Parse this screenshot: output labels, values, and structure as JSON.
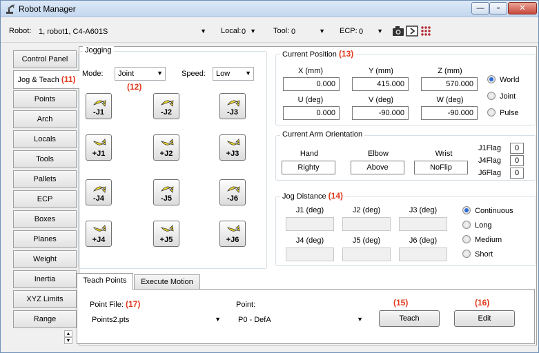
{
  "window": {
    "title": "Robot Manager",
    "close_glyph": "✕",
    "min_glyph": "—",
    "max_glyph": "▫"
  },
  "toolbar": {
    "robot_label": "Robot:",
    "robot_value": "1, robot1, C4-A601S",
    "local_label": "Local:",
    "local_value": "0",
    "tool_label": "Tool:",
    "tool_value": "0",
    "ecp_label": "ECP:",
    "ecp_value": "0",
    "icons": [
      "camera-icon",
      "play-icon",
      "io-grid-icon"
    ]
  },
  "left_tabs": [
    {
      "label": "Control Panel"
    },
    {
      "label": "Jog & Teach",
      "annotation": "(11)"
    },
    {
      "label": "Points"
    },
    {
      "label": "Arch"
    },
    {
      "label": "Locals"
    },
    {
      "label": "Tools"
    },
    {
      "label": "Pallets"
    },
    {
      "label": "ECP"
    },
    {
      "label": "Boxes"
    },
    {
      "label": "Planes"
    },
    {
      "label": "Weight"
    },
    {
      "label": "Inertia"
    },
    {
      "label": "XYZ Limits"
    },
    {
      "label": "Range"
    }
  ],
  "jogging": {
    "title": "Jogging",
    "mode_label": "Mode:",
    "mode_value": "Joint",
    "annotation": "(12)",
    "speed_label": "Speed:",
    "speed_value": "Low",
    "buttons": [
      "-J1",
      "-J2",
      "-J3",
      "+J1",
      "+J2",
      "+J3",
      "-J4",
      "-J5",
      "-J6",
      "+J4",
      "+J5",
      "+J6"
    ]
  },
  "current_position": {
    "title": "Current Position",
    "annotation": "(13)",
    "labels": [
      "X (mm)",
      "Y (mm)",
      "Z (mm)",
      "U (deg)",
      "V (deg)",
      "W (deg)"
    ],
    "values": [
      "0.000",
      "415.000",
      "570.000",
      "0.000",
      "-90.000",
      "-90.000"
    ],
    "modes": [
      "World",
      "Joint",
      "Pulse"
    ],
    "selected_mode": "World"
  },
  "arm_orientation": {
    "title": "Current Arm Orientation",
    "labels": [
      "Hand",
      "Elbow",
      "Wrist"
    ],
    "values": [
      "Righty",
      "Above",
      "NoFlip"
    ],
    "flags": [
      {
        "label": "J1Flag",
        "value": "0"
      },
      {
        "label": "J4Flag",
        "value": "0"
      },
      {
        "label": "J6Flag",
        "value": "0"
      }
    ]
  },
  "jog_distance": {
    "title": "Jog Distance",
    "annotation": "(14)",
    "labels": [
      "J1 (deg)",
      "J2 (deg)",
      "J3 (deg)",
      "J4 (deg)",
      "J5 (deg)",
      "J6 (deg)"
    ],
    "options": [
      "Continuous",
      "Long",
      "Medium",
      "Short"
    ],
    "selected_option": "Continuous"
  },
  "bottom_tabs": [
    "Teach Points",
    "Execute Motion"
  ],
  "teach": {
    "point_file_label": "Point File:",
    "point_file_annotation": "(17)",
    "point_file_value": "Points2.pts",
    "point_label": "Point:",
    "point_value": "P0 - DefA",
    "teach_button": "Teach",
    "teach_annotation": "(15)",
    "edit_button": "Edit",
    "edit_annotation": "(16)"
  },
  "colors": {
    "annotation_red": "#e03a1e",
    "radio_selected": "#2c6bd6",
    "jog_arrow_yellow": "#f3dc2a"
  }
}
